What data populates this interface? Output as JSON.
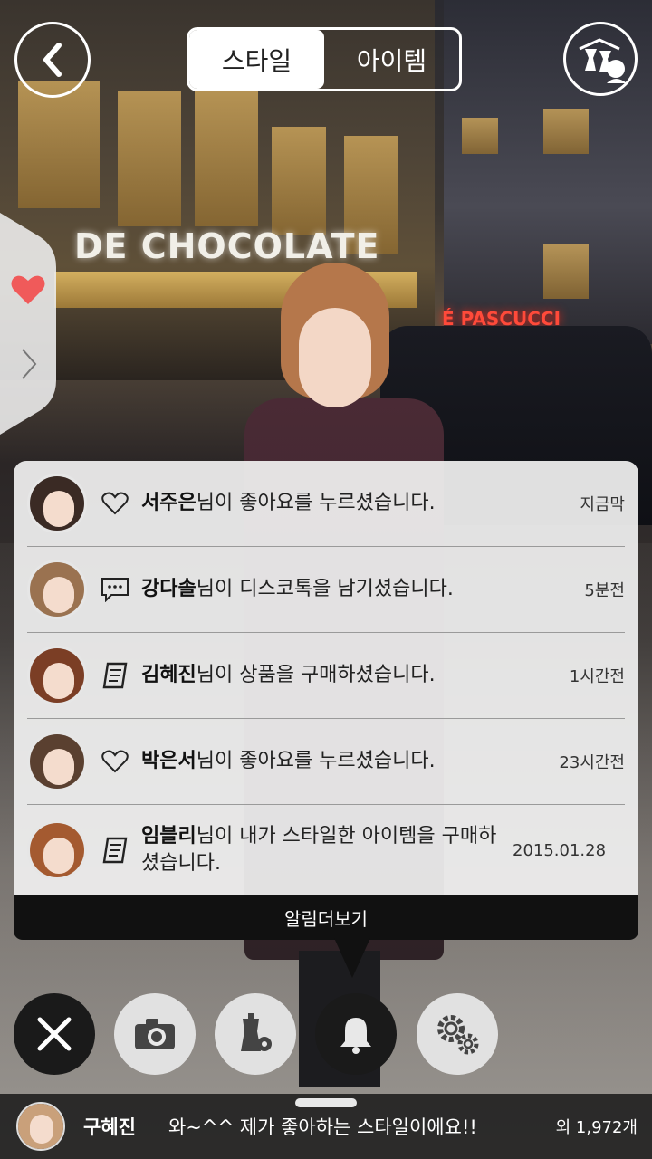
{
  "header": {
    "tabs": [
      {
        "label": "스타일",
        "active": true
      },
      {
        "label": "아이템",
        "active": false
      }
    ],
    "back_icon": "chevron-left-icon",
    "closet_icon": "hanger-closet-icon"
  },
  "side_tab": {
    "heart_icon": "heart-icon",
    "expand_icon": "chevron-right-icon",
    "heart_color": "#f05a5a"
  },
  "notifications": [
    {
      "name": "서주은",
      "text": "님이 좋아요를 누르셨습니다.",
      "time": "지금막",
      "icon": "heart-outline-icon"
    },
    {
      "name": "강다솔",
      "text": "님이 디스코톡을 남기셨습니다.",
      "time": "5분전",
      "icon": "chat-bubble-icon"
    },
    {
      "name": "김혜진",
      "text": "님이 상품을 구매하셨습니다.",
      "time": "1시간전",
      "icon": "receipt-icon"
    },
    {
      "name": "박은서",
      "text": "님이 좋아요를 누르셨습니다.",
      "time": "23시간전",
      "icon": "heart-outline-icon"
    },
    {
      "name": "임블리",
      "text": "님이 내가 스타일한 아이템을 구매하셨습니다.",
      "time": "2015.01.28",
      "icon": "receipt-icon"
    }
  ],
  "more_label": "알림더보기",
  "actions": [
    {
      "icon": "close-icon",
      "style": "dark"
    },
    {
      "icon": "camera-icon",
      "style": "light"
    },
    {
      "icon": "mannequin-settings-icon",
      "style": "light"
    },
    {
      "icon": "bell-icon",
      "style": "dark"
    },
    {
      "icon": "gears-icon",
      "style": "light"
    }
  ],
  "bottom_bar": {
    "user_name": "구혜진",
    "comment": "와~^^ 제가 좋아하는 스타일이에요!!",
    "count": "외 1,972개"
  }
}
